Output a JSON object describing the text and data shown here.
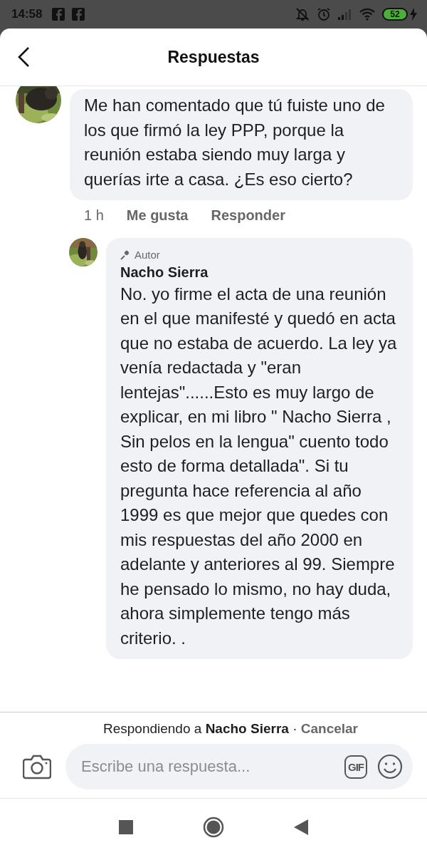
{
  "status_bar": {
    "time": "14:58",
    "battery": "52"
  },
  "header": {
    "title": "Respuestas"
  },
  "comments": [
    {
      "kind": "comment",
      "text": "Me han comentado que tú fuiste uno de los que firmó la ley PPP, porque la reunión estaba siendo muy larga y querías irte a casa. ¿Es eso cierto?",
      "time": "1 h",
      "actions": [
        "Me gusta",
        "Responder"
      ]
    },
    {
      "kind": "reply",
      "badge": "Autor",
      "author": "Nacho Sierra",
      "text": "No. yo firme el acta de una reunión en el que manifesté y quedó en acta que no estaba de acuerdo. La ley ya venía redactada y \"eran lentejas\"......Esto es muy largo de explicar, en mi libro \" Nacho Sierra , Sin pelos en la lengua\" cuento todo esto de forma detallada\". Si tu pregunta hace referencia al año 1999 es que mejor que quedes con mis respuestas del año 2000 en adelante y anteriores al 99. Siempre he pensado lo mismo, no hay duda, ahora simplemente tengo más criterio. ."
    }
  ],
  "composer": {
    "replying_note": "Respondiendo a **Nacho Sierra** ·",
    "cancel": "Cancelar",
    "placeholder": "Escribe una respuesta...",
    "gif": "GIF"
  }
}
